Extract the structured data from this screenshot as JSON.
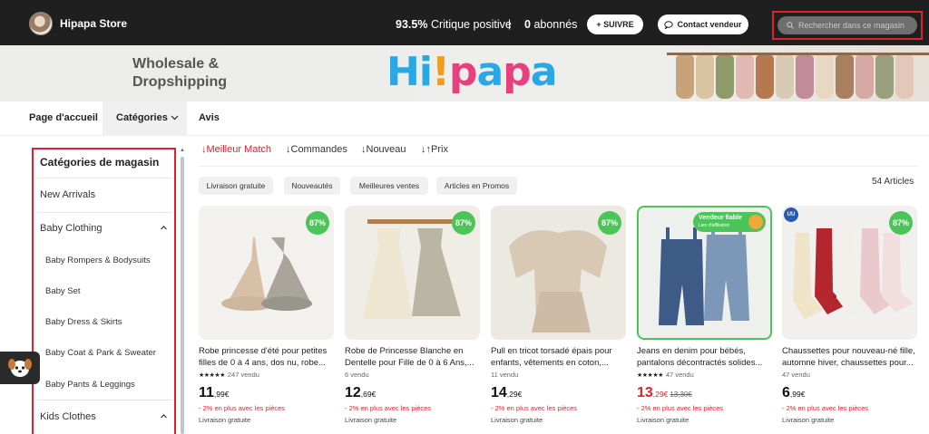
{
  "header": {
    "store_name": "Hipapa Store",
    "rating_value": "93.5%",
    "rating_label": "Critique positive",
    "separator": "|",
    "followers_count": "0",
    "followers_label": "abonnés",
    "follow_button": "+ SUIVRE",
    "contact_button": "Contact vendeur",
    "search_placeholder": "Rechercher dans ce magasin"
  },
  "banner": {
    "line1": "Wholesale &",
    "line2": "Dropshipping",
    "logo_text": "Hi!papa"
  },
  "nav": {
    "home": "Page d'accueil",
    "categories": "Catégories",
    "reviews": "Avis"
  },
  "sidebar": {
    "title": "Catégories de magasin",
    "items": [
      {
        "label": "New Arrivals"
      },
      {
        "label": "Baby Clothing"
      },
      {
        "label": "Baby Rompers & Bodysuits"
      },
      {
        "label": "Baby Set"
      },
      {
        "label": "Baby Dress & Skirts"
      },
      {
        "label": "Baby Coat & Park & Sweater"
      },
      {
        "label": "Baby Pants & Leggings"
      },
      {
        "label": "Kids Clothes"
      }
    ]
  },
  "sort": {
    "best_match": "↓Meilleur Match",
    "orders": "↓Commandes",
    "newest": "↓Nouveau",
    "price": "↓↑Prix"
  },
  "filters": [
    "Livraison gratuite",
    "Nouveautés",
    "Meilleures ventes",
    "Articles en Promos"
  ],
  "article_count": "54 Articles",
  "colors": {
    "accent_red": "#e0202a",
    "badge_green": "#4cc45a",
    "topbar": "#1f1f1f"
  },
  "products": [
    {
      "discount": "87%",
      "title": "Robe princesse d'été pour petites filles de 0 à 4 ans, dos nu, robe...",
      "stars": "★★★★★",
      "sold": "247 vendu",
      "price_int": "11",
      "price_dec": ",99€",
      "promo": "- 2% en plus avec les pièces",
      "shipping": "Livraison gratuite"
    },
    {
      "discount": "87%",
      "title": "Robe de Princesse Blanche en Dentelle pour Fille de 0 à 6 Ans,...",
      "stars": "",
      "sold": "6 vendu",
      "price_int": "12",
      "price_dec": ",69€",
      "promo": "- 2% en plus avec les pièces",
      "shipping": "Livraison gratuite"
    },
    {
      "discount": "87%",
      "title": "Pull en tricot torsadé épais pour enfants, vêtements en coton,...",
      "stars": "",
      "sold": "11 vendu",
      "price_int": "14",
      "price_dec": ",29€",
      "promo": "- 2% en plus avec les pièces",
      "shipping": "Livraison gratuite"
    },
    {
      "badge_title": "Vendeur fiable",
      "badge_sub": "Lien d'affiliation",
      "title": "Jeans en denim pour bébés, pantalons décontractés solides...",
      "stars": "★★★★★",
      "sold": "47 vendu",
      "price_int": "13",
      "price_dec": ",29€",
      "price_old": "13,30€",
      "promo": "- 2% en plus avec les pièces",
      "shipping": "Livraison gratuite"
    },
    {
      "discount": "87%",
      "brand": "UU",
      "title": "Chaussettes pour nouveau-né fille, automne hiver, chaussettes pour...",
      "stars": "",
      "sold": "47 vendu",
      "price_int": "6",
      "price_dec": ",99€",
      "promo": "- 2% en plus avec les pièces",
      "shipping": "Livraison gratuite"
    }
  ]
}
